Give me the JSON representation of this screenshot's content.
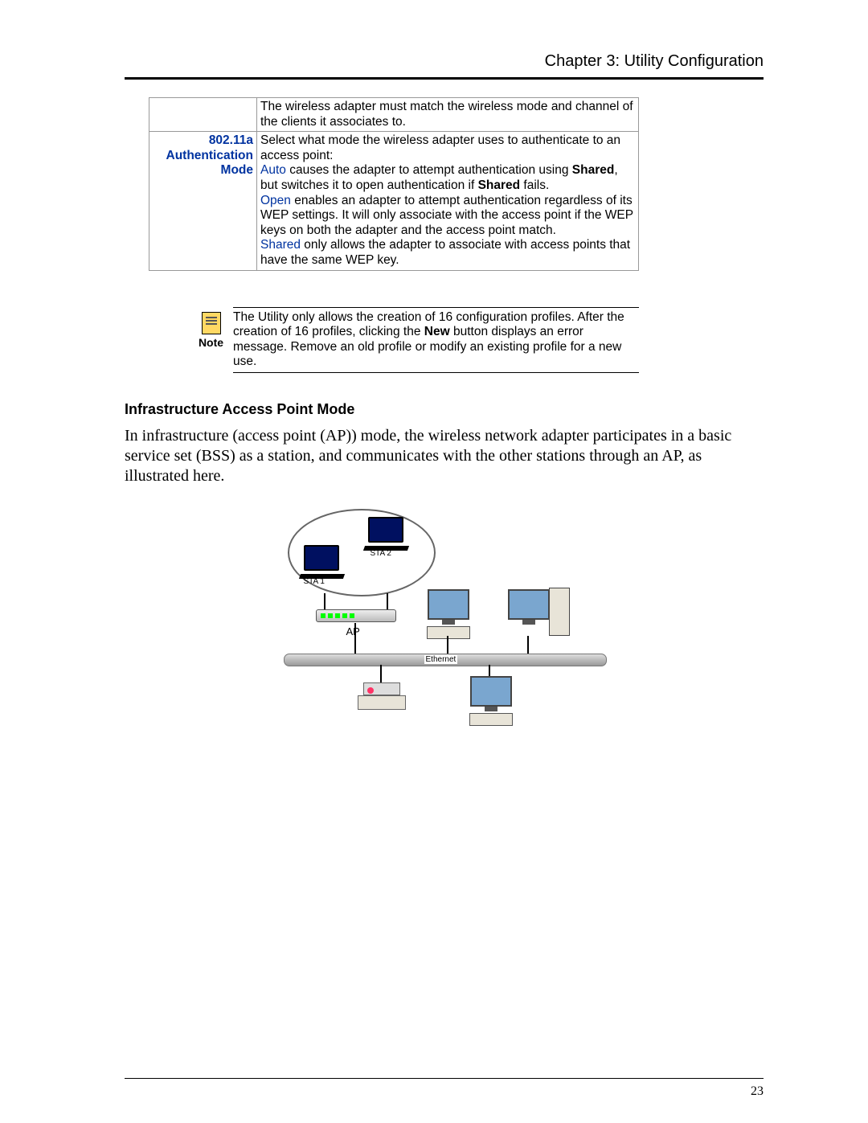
{
  "header": {
    "chapter": "Chapter 3: Utility Configuration"
  },
  "table": {
    "row1": {
      "label": "",
      "desc": "The wireless adapter must match the wireless mode and channel of the clients it associates to."
    },
    "row2": {
      "label_line1": "802.11a",
      "label_line2": "Authentication",
      "label_line3": "Mode",
      "lead": "Select what mode the wireless adapter uses to authenticate to an access point:",
      "auto_k": "Auto",
      "auto_t": " causes the adapter to attempt authentication using ",
      "shared1": "Shared",
      "auto_t2": ", but switches it to open authentication if ",
      "shared2": "Shared",
      "auto_t3": " fails.",
      "open_k": "Open",
      "open_t": " enables an adapter to attempt authentication regardless of its WEP settings. It will only associate with the access point if the WEP keys on both the adapter and the access point match.",
      "shared_k": "Shared",
      "shared_t": " only allows the adapter to associate with access points that have the same WEP key."
    }
  },
  "note": {
    "label": "Note",
    "pre": "The Utility only allows the creation of 16 configuration profiles. After the creation of 16 profiles, clicking the ",
    "bold": "New",
    "post": " button displays an error message. Remove an old profile or modify an existing profile for a new use."
  },
  "section": {
    "title": "Infrastructure Access Point Mode"
  },
  "body": {
    "p1": "In infrastructure (access point (AP)) mode, the wireless network adapter participates in a basic service set (BSS) as a station, and communicates with the other stations through an AP, as illustrated here."
  },
  "diagram": {
    "sta1": "STA 1",
    "sta2": "STA 2",
    "ap": "AP",
    "eth": "Ethernet"
  },
  "page_number": "23"
}
